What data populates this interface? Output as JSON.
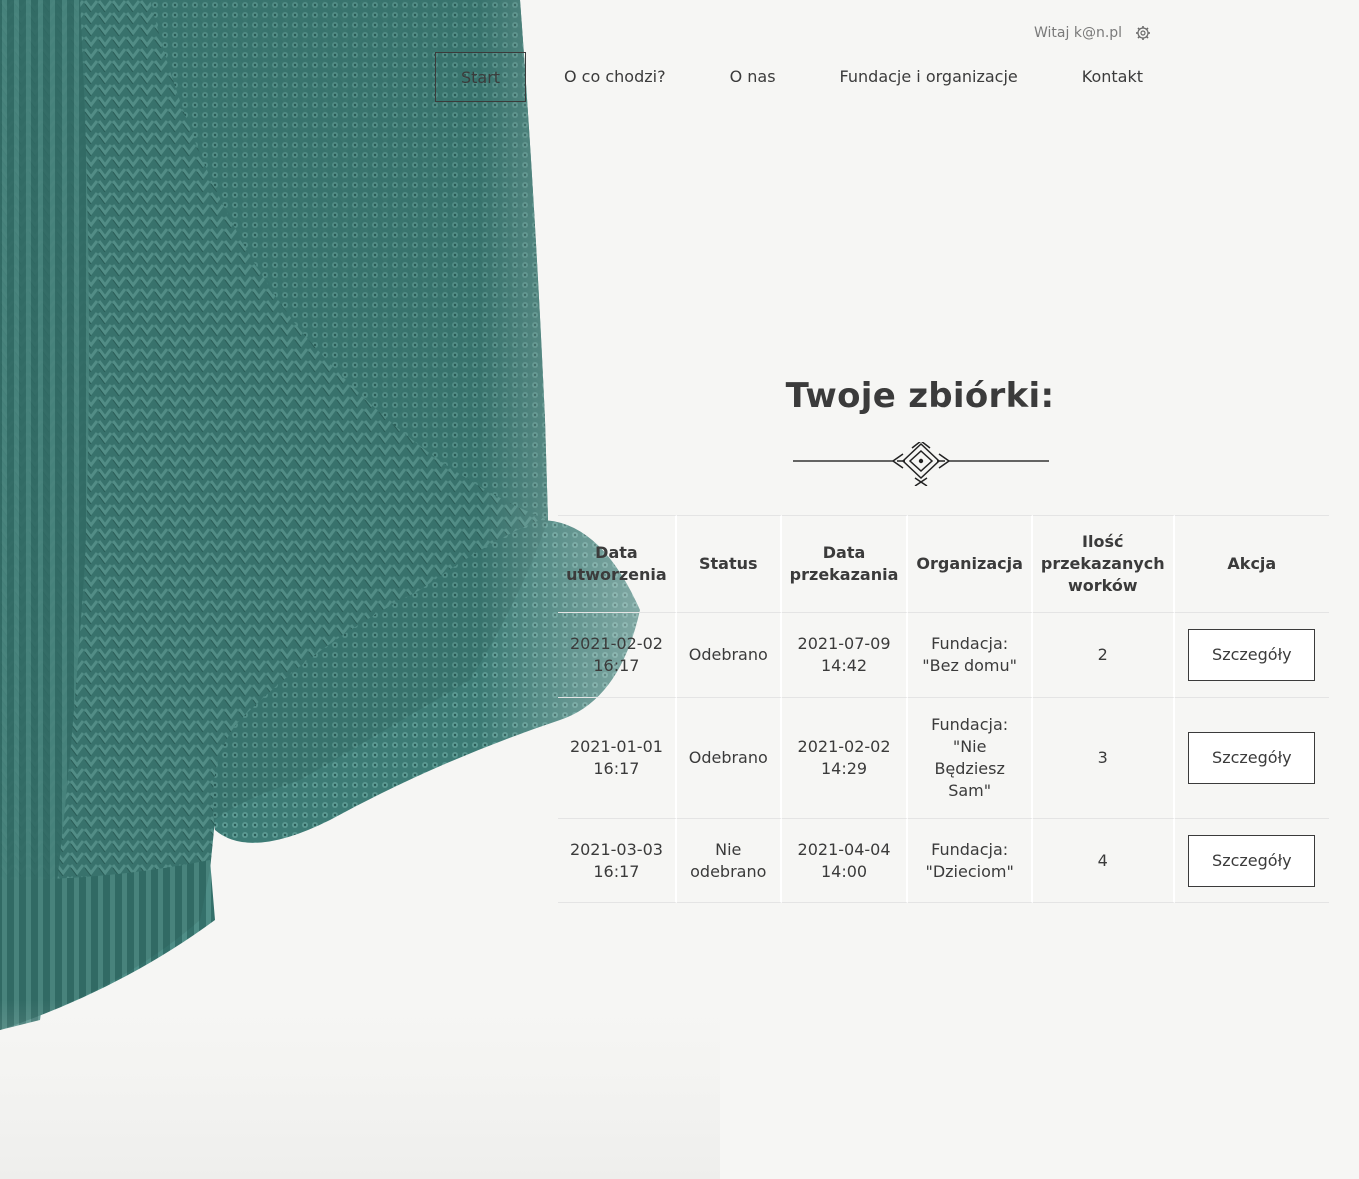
{
  "header": {
    "greeting": "Witaj k@n.pl",
    "settings_icon": "gear-icon"
  },
  "nav": {
    "items": [
      {
        "label": "Start",
        "active": true
      },
      {
        "label": "O co chodzi?",
        "active": false
      },
      {
        "label": "O nas",
        "active": false
      },
      {
        "label": "Fundacje i organizacje",
        "active": false
      },
      {
        "label": "Kontakt",
        "active": false
      }
    ]
  },
  "main": {
    "title": "Twoje zbiórki:",
    "decoration_icon": "ornament-divider-icon"
  },
  "table": {
    "headers": {
      "created": "Data utworzenia",
      "status": "Status",
      "handover": "Data przekazania",
      "organization": "Organizacja",
      "bags": "Ilość przekazanych worków",
      "action": "Akcja"
    },
    "rows": [
      {
        "created": "2021-02-02 16:17",
        "status": "Odebrano",
        "handover": "2021-07-09 14:42",
        "organization": "Fundacja: \"Bez domu\"",
        "bags": "2",
        "action": "Szczegóły"
      },
      {
        "created": "2021-01-01 16:17",
        "status": "Odebrano",
        "handover": "2021-02-02 14:29",
        "organization": "Fundacja: \"Nie Będziesz Sam\"",
        "bags": "3",
        "action": "Szczegóły"
      },
      {
        "created": "2021-03-03 16:17",
        "status": "Nie odebrano",
        "handover": "2021-04-04 14:00",
        "organization": "Fundacja: \"Dzieciom\"",
        "bags": "4",
        "action": "Szczegóły"
      }
    ]
  },
  "colors": {
    "text": "#3b3b3b",
    "sweater": "#3f7f79",
    "background": "#f6f6f4"
  }
}
